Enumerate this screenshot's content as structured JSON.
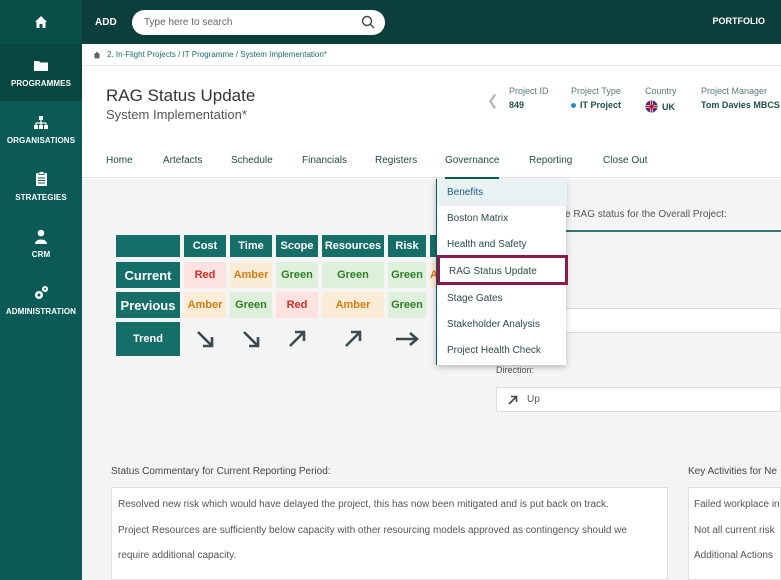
{
  "sidebar": {
    "home_icon": "home-icon",
    "items": [
      {
        "label": "PROGRAMMES",
        "icon": "folder-icon"
      },
      {
        "label": "ORGANISATIONS",
        "icon": "org-chart-icon"
      },
      {
        "label": "STRATEGIES",
        "icon": "clipboard-icon"
      },
      {
        "label": "CRM",
        "icon": "person-icon"
      },
      {
        "label": "ADMINISTRATION",
        "icon": "gears-icon"
      }
    ]
  },
  "topbar": {
    "add_label": "ADD",
    "search_placeholder": "Type here to search",
    "portfolio_label": "PORTFOLIO"
  },
  "breadcrumb": {
    "text": "2. In-Flight Projects / IT Programme / System Implementation*"
  },
  "header": {
    "title": "RAG Status Update",
    "subtitle": "System Implementation*",
    "meta": [
      {
        "label": "Project ID",
        "value": "849"
      },
      {
        "label": "Project Type",
        "value": "IT Project"
      },
      {
        "label": "Country",
        "value": "UK"
      },
      {
        "label": "Project Manager",
        "value": "Tom Davies MBCS"
      }
    ]
  },
  "tabs": [
    "Home",
    "Artefacts",
    "Schedule",
    "Financials",
    "Registers",
    "Governance",
    "Reporting",
    "Close Out"
  ],
  "active_tab": "Governance",
  "rag_table": {
    "columns": [
      "Cost",
      "Time",
      "Scope",
      "Resources",
      "Risk"
    ],
    "rows": [
      {
        "label": "Current",
        "values": [
          "Red",
          "Amber",
          "Green",
          "Green",
          "Green"
        ]
      },
      {
        "label": "Previous",
        "values": [
          "Amber",
          "Green",
          "Red",
          "Amber",
          "Green"
        ]
      },
      {
        "label": "Trend",
        "values": [
          "down-right",
          "down-right",
          "up-right",
          "up-right",
          "right"
        ]
      }
    ],
    "partial_letter": "A"
  },
  "dropdown": {
    "items": [
      "Benefits",
      "Boston Matrix",
      "Health and Safety",
      "RAG Status Update",
      "Stage Gates",
      "Stakeholder Analysis",
      "Project Health Check"
    ],
    "highlighted": "RAG Status Update"
  },
  "panel": {
    "heading_partial": "e RAG status for the Overall Project:",
    "direction_label": "Direction:",
    "direction_value": "Up"
  },
  "commentary": {
    "label": "Status Commentary for Current Reporting Period:",
    "lines": [
      "Resolved new risk which would have delayed the project, this has now been mitigated and is put back on track.",
      "Project Resources are sufficiently below capacity with other resourcing models approved as contingency should we",
      "require additional capacity."
    ]
  },
  "activities": {
    "label": "Key Activities for Ne",
    "lines": [
      "Failed workplace in",
      "Not all current risk",
      "Additional Actions"
    ]
  },
  "colors": {
    "sidebar": "#0a5b55",
    "topbar": "#0c3e3b",
    "header_cell": "#156e68",
    "red": "#d72c26",
    "amber": "#d17d12",
    "green": "#2e7d26",
    "highlight_border": "#8a1a4d"
  }
}
